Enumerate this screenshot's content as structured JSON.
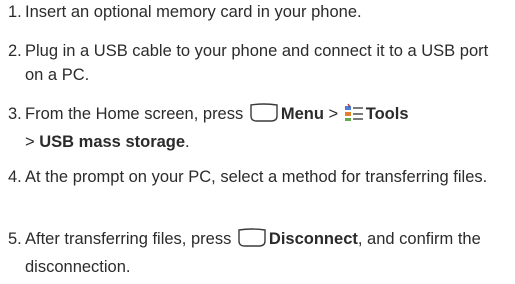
{
  "steps": [
    {
      "number": "1.",
      "text": "Insert an optional memory card in your phone."
    },
    {
      "number": "2.",
      "text": "Plug in a USB cable to your phone and connect it to a USB port on a PC."
    },
    {
      "number": "3.",
      "text_before": "From the Home screen, press ",
      "softkey_icon": "softkey-icon",
      "menu_label": "Menu",
      "separator1": " > ",
      "tools_icon": "tools-icon",
      "tools_label": "Tools",
      "separator2": "> ",
      "usb_label": "USB mass storage",
      "end": "."
    },
    {
      "number": "4.",
      "text": "At the prompt on your PC, select a method for transferring files."
    },
    {
      "number": "5.",
      "text_before": "After transferring files, press ",
      "softkey_icon": "softkey-icon",
      "disconnect_label": "Disconnect",
      "text_after": ", and confirm the disconnection."
    }
  ],
  "colors": {
    "text": "#2b2b2b",
    "softkey_fill": "#ffffff",
    "softkey_stroke": "#3a3a3a"
  }
}
